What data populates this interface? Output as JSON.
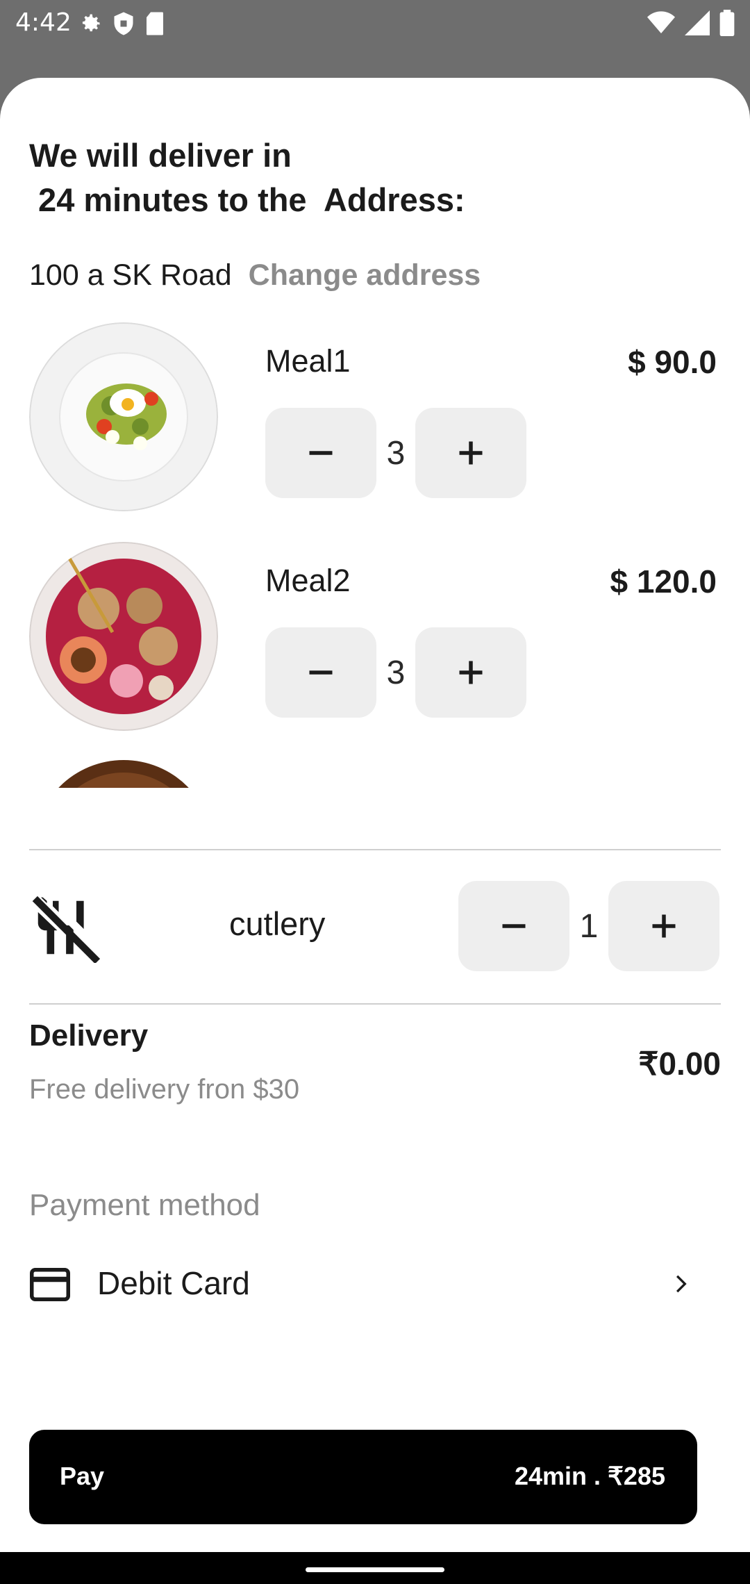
{
  "status_bar": {
    "time": "4:42",
    "icons_left": [
      "gear-icon",
      "shield-icon",
      "sd-card-icon"
    ],
    "icons_right": [
      "wifi-icon",
      "signal-icon",
      "battery-icon"
    ]
  },
  "sheet": {
    "heading": "We will deliver in\n 24 minutes to the  Address:",
    "address": "100 a SK Road",
    "change_address": "Change address"
  },
  "items": [
    {
      "name": "Meal1",
      "price": "$ 90.0",
      "quantity": "3"
    },
    {
      "name": "Meal2",
      "price": "$ 120.0",
      "quantity": "3"
    }
  ],
  "cutlery": {
    "label": "cutlery",
    "quantity": "1"
  },
  "delivery": {
    "title": "Delivery",
    "subtitle": "Free delivery fron $30",
    "price": "₹0.00"
  },
  "payment": {
    "label": "Payment method",
    "method": "Debit Card"
  },
  "pay_button": {
    "label": "Pay",
    "summary": "24min . ₹285"
  }
}
